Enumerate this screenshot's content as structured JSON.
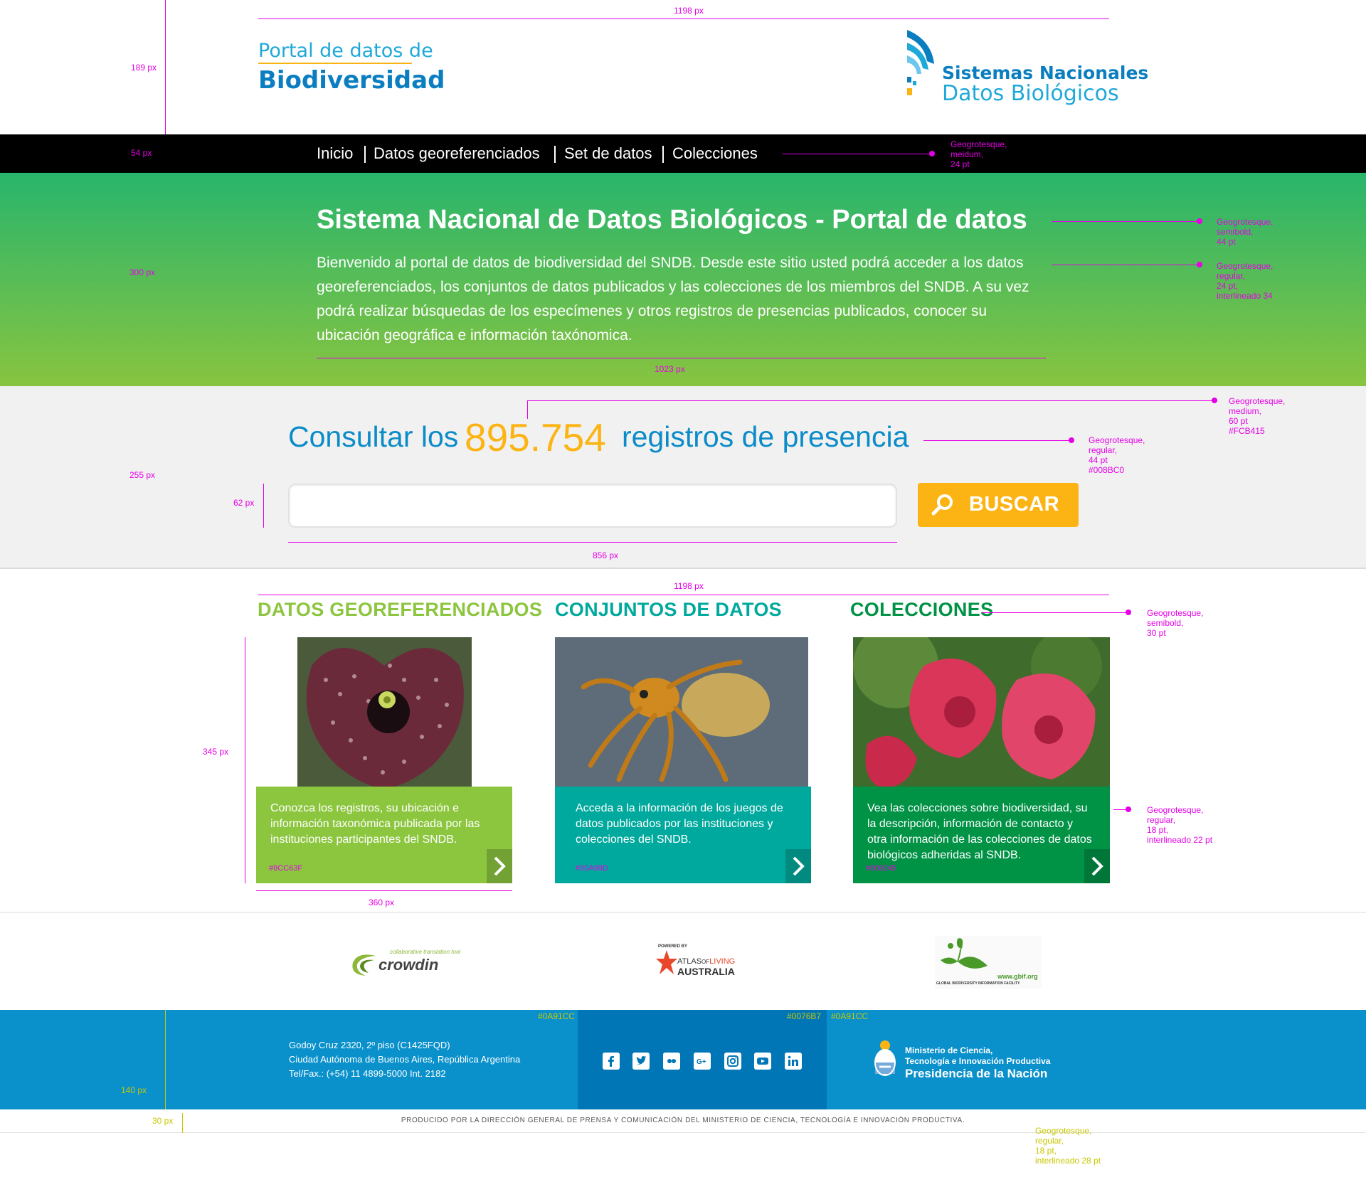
{
  "header": {
    "brand_top": "Portal de datos de",
    "brand_main": "Biodiversidad",
    "logo_line1": "Sistemas Nacionales",
    "logo_line2": "Datos Biológicos"
  },
  "nav": {
    "items": [
      {
        "label": "Inicio"
      },
      {
        "label": "Datos georeferenciados"
      },
      {
        "label": "Set de datos"
      },
      {
        "label": "Colecciones"
      }
    ]
  },
  "hero": {
    "title": "Sistema Nacional de Datos Biológicos - Portal de datos",
    "description": "Bienvenido al portal de datos de biodiversidad del SNDB. Desde este sitio usted podrá acceder a los datos georeferenciados, los conjuntos de datos publicados y las colecciones de los miembros del SNDB. A su vez podrá realizar búsquedas de los especímenes y otros registros de presencias publicados, conocer su ubicación geográfica e información taxónomica."
  },
  "search": {
    "prefix": "Consultar los",
    "count": "895.754",
    "suffix": "registros de presencia",
    "input_value": "",
    "button_label": "BUSCAR"
  },
  "sections": [
    {
      "title": "DATOS GEOREFERENCIADOS",
      "text": "Conozca los registros, su ubicación e información taxonómica publicada por las instituciones participantes del SNDB.",
      "color": "#8CC63F",
      "color_label": "#8CC63F"
    },
    {
      "title": "CONJUNTOS DE DATOS",
      "text": "Acceda a la información de los juegos de datos publicados por las instituciones y colecciones del SNDB.",
      "color": "#00A99D",
      "color_label": "#00A99D"
    },
    {
      "title": "COLECCIONES",
      "text": "Vea las colecciones sobre biodiversidad, su la descripción, información de contacto y otra información de las colecciones de datos biológicos adheridas al SNDB.",
      "color": "#009245",
      "color_label": "#009245"
    }
  ],
  "partners": {
    "crowdin_tag": "collaborative translation tool",
    "crowdin": "crowdin",
    "ala_powered": "POWERED BY",
    "ala_atlas": "ATLAS",
    "ala_of": "OF",
    "ala_living": "LIVING",
    "ala_australia": "AUSTRALIA",
    "gbif_url": "www.gbif.org",
    "gbif_name": "GLOBAL BIODIVERSITY INFORMATION FACILITY"
  },
  "footer": {
    "address_line1": "Godoy Cruz 2320, 2º piso (C1425FQD)",
    "address_line2": "Ciudad Autónoma de Buenos Aires, República Argentina",
    "address_line3": "Tel/Fax.: (+54) 11 4899-5000 Int. 2182",
    "social": [
      "facebook-icon",
      "twitter-icon",
      "flickr-icon",
      "google-plus-icon",
      "instagram-icon",
      "youtube-icon",
      "linkedin-icon"
    ],
    "ministry_line1": "Ministerio de Ciencia,",
    "ministry_line2": "Tecnología e Innovación Productiva",
    "ministry_line3": "Presidencia de la Nación",
    "produced": "PRODUCIDO POR LA DIRECCIÓN GENERAL DE PRENSA Y COMUNICACIÓN DEL MINISTERIO DE CIENCIA, TECNOLOGÍA E INNOVACIÓN PRODUCTIVA."
  },
  "annotations": {
    "w_top": "1198 px",
    "h_header": "189 px",
    "h_nav": "54 px",
    "nav_font_1": "Geogrotesque,",
    "nav_font_2": "meidum,",
    "nav_font_3": "24 pt",
    "h_hero": "300 px",
    "hero_title_1": "Geogrotesque,",
    "hero_title_2": "semibold,",
    "hero_title_3": "44 pt",
    "hero_desc_1": "Geogrotesque,",
    "hero_desc_2": "regular,",
    "hero_desc_3": "24 pt,",
    "hero_desc_4": "interlineado 34",
    "w_hero": "1023 px",
    "num_1": "Geogrotesque,",
    "num_2": "medium,",
    "num_3": "60 pt",
    "num_4": "#FCB415",
    "cnt_1": "Geogrotesque,",
    "cnt_2": "regular,",
    "cnt_3": "44 pt",
    "cnt_4": "#008BC0",
    "h_band": "255 px",
    "h_input": "62 px",
    "w_input": "856 px",
    "w_sections": "1198 px",
    "sec_1": "Geogrotesque,",
    "sec_2": "semibold,",
    "sec_3": "30 pt",
    "h_card": "345 px",
    "card_1": "Geogrotesque,",
    "card_2": "regular,",
    "card_3": "18 pt,",
    "card_4": "interlineado 22 pt",
    "w_card": "360 px",
    "f_col1": "#0A91CC",
    "f_col2": "#0076B7",
    "f_col3": "#0A91CC",
    "h_footer": "140 px",
    "h_bottom": "30 px",
    "ft_1": "Geogrotesque,",
    "ft_2": "regular,",
    "ft_3": "18 pt,",
    "ft_4": "interlineado 28 pt"
  }
}
